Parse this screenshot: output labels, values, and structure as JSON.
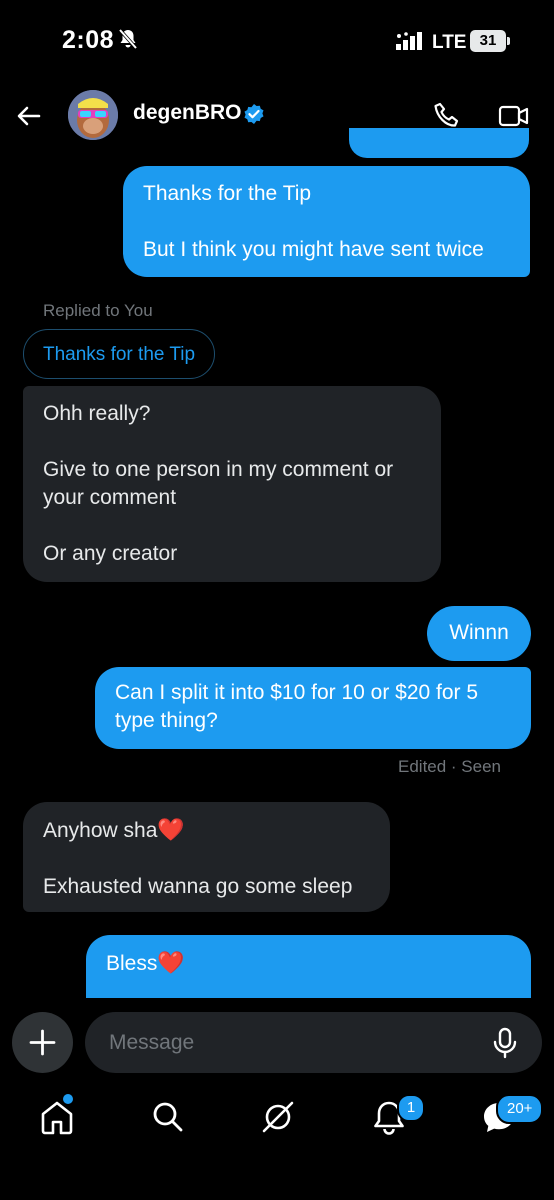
{
  "status_bar": {
    "time": "2:08",
    "network": "LTE",
    "battery": "31",
    "icons": [
      "mute-icon",
      "signal-icon",
      "battery-icon"
    ]
  },
  "header": {
    "contact_name": "degenBRO",
    "icons": [
      "back-arrow-icon",
      "avatar",
      "verified-badge-icon",
      "phone-icon",
      "video-call-icon"
    ]
  },
  "messages": [
    {
      "from": "me",
      "lines": [
        "Thanks for the Tip",
        "But I think you might have sent twice"
      ]
    },
    {
      "from": "them",
      "replied_label": "Replied to You",
      "reply_quote": "Thanks for the Tip",
      "lines": [
        "Ohh really?",
        "Give to one person in my comment or your comment",
        "Or any creator"
      ]
    },
    {
      "from": "me",
      "lines": [
        "Winnn"
      ]
    },
    {
      "from": "me",
      "lines": [
        "Can I split it into $10 for 10 or $20 for 5 type thing?"
      ],
      "meta": "Edited · Seen"
    },
    {
      "from": "them",
      "lines": [
        "Anyhow sha",
        "Exhausted wanna go some sleep"
      ],
      "emoji": "❤️"
    },
    {
      "from": "me",
      "lines": [
        "Bless"
      ],
      "emoji": "❤️"
    }
  ],
  "composer": {
    "placeholder": "Message",
    "icons": [
      "plus-icon",
      "mic-icon"
    ]
  },
  "bottom_nav": {
    "items": [
      "home",
      "search",
      "grok",
      "notifications",
      "messages"
    ],
    "notifications_badge": "1",
    "messages_badge": "20+"
  },
  "colors": {
    "accent": "#1d9bf0",
    "incoming_bubble": "#202327",
    "background": "#000000",
    "secondary_text": "#71767b"
  }
}
